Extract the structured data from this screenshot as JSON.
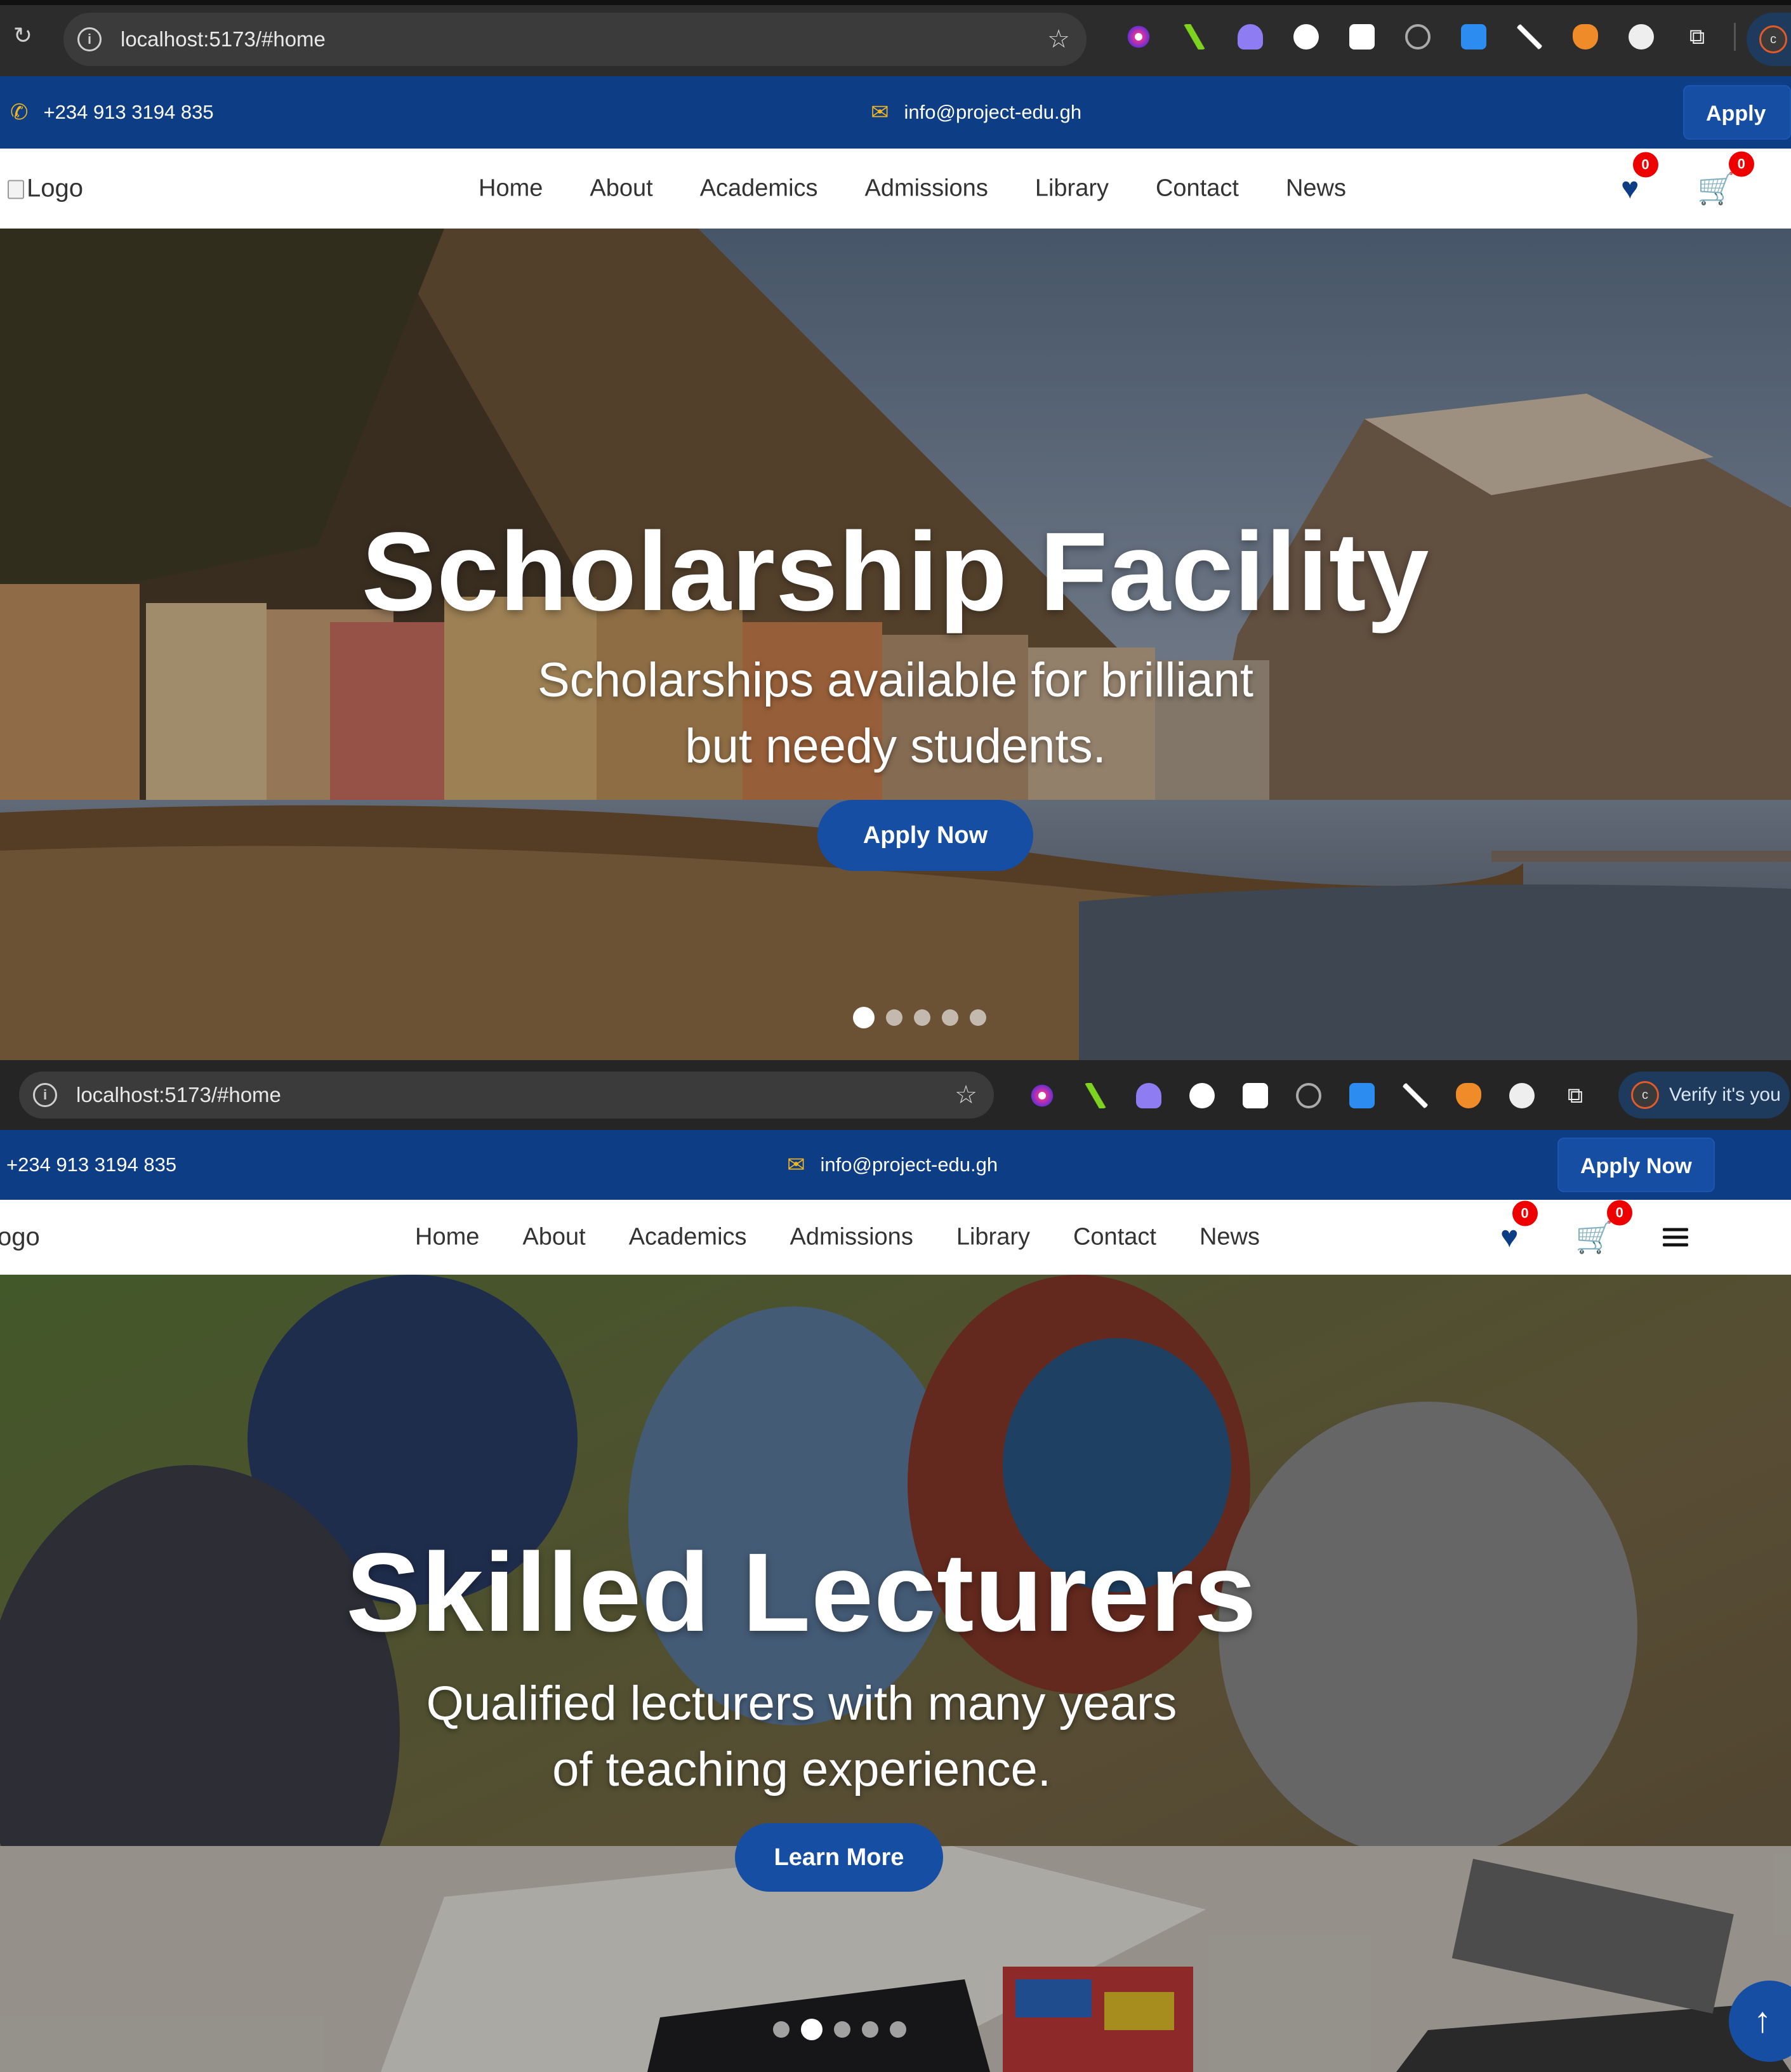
{
  "browser": {
    "url": "localhost:5173/#home",
    "verify_label": "Verify it's you",
    "extensions": [
      "color-picker-icon",
      "chart-extension-icon",
      "ghost-extension-icon",
      "dots-extension-icon",
      "wand-extension-icon",
      "target-extension-icon",
      "download-extension-icon",
      "pen-extension-icon",
      "fox-extension-icon",
      "circle-extension-icon",
      "puzzle-icon"
    ]
  },
  "topbar": {
    "phone": "+234 913 3194 835",
    "email": "info@project-edu.gh",
    "apply_label": "Apply Now",
    "apply_label_clipped": "Apply N"
  },
  "navbar": {
    "logo_alt": "Logo",
    "logo_alt_clipped": "ogo",
    "items": [
      "Home",
      "About",
      "Academics",
      "Admissions",
      "Library",
      "Contact",
      "News"
    ],
    "wishlist_count": "0",
    "cart_count": "0"
  },
  "slides": [
    {
      "title": "Scholarship Facility",
      "subtitle_line1": "Scholarships available for brilliant",
      "subtitle_line2": "but needy students.",
      "button": "Apply Now",
      "active_dot": 1,
      "dot_count": 5
    },
    {
      "title": "Skilled Lecturers",
      "subtitle_line1": "Qualified lecturers with many years",
      "subtitle_line2": "of teaching experience.",
      "button": "Learn More",
      "active_dot": 2,
      "dot_count": 5
    }
  ],
  "colors": {
    "brand_blue": "#0d3d84",
    "button_blue": "#164ea3",
    "accent_yellow": "#f3b61f",
    "badge_red": "#e00000"
  },
  "scroll_top_icon": "arrow-up-icon"
}
